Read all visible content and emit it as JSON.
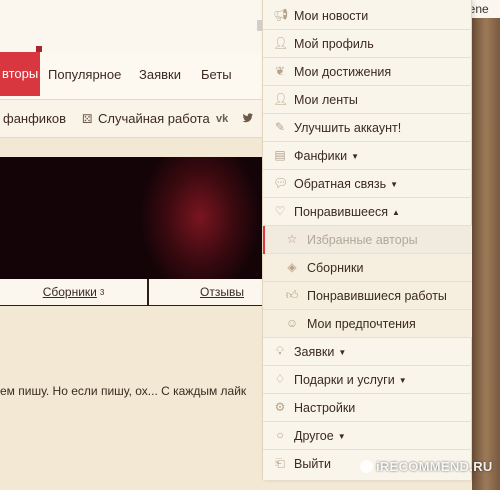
{
  "user": {
    "name": "Eirene"
  },
  "nav": {
    "active_label": "вторы",
    "items": [
      "Популярное",
      "Заявки",
      "Беты"
    ]
  },
  "subnav": {
    "fanfics_label": "фанфиков",
    "random_work_label": "Случайная работа",
    "vk_label": "vk",
    "twitter_icon": "twitter-icon"
  },
  "tabs": {
    "collections_label": "Сборники",
    "collections_count": "3",
    "reviews_label": "Отзывы"
  },
  "body": {
    "text": "ем пишу. Но если пишу, ох... С каждым лайк"
  },
  "menu": {
    "items": [
      {
        "label": "Мои новости",
        "icon": "megaphone-icon"
      },
      {
        "label": "Мой профиль",
        "icon": "user-icon"
      },
      {
        "label": "Мои достижения",
        "icon": "laurel-icon"
      },
      {
        "label": "Мои ленты",
        "icon": "person-feed-icon"
      },
      {
        "label": "Улучшить аккаунт!",
        "icon": "upgrade-icon"
      },
      {
        "label": "Фанфики",
        "icon": "books-icon"
      },
      {
        "label": "Обратная связь",
        "icon": "chat-icon"
      },
      {
        "label": "Понравившееся",
        "icon": "heart-icon"
      },
      {
        "label": "Избранные авторы",
        "icon": "star-icon"
      },
      {
        "label": "Сборники",
        "icon": "layers-icon"
      },
      {
        "label": "Понравившиеся работы",
        "icon": "thumbs-up-icon"
      },
      {
        "label": "Мои предпочтения",
        "icon": "masks-icon"
      },
      {
        "label": "Заявки",
        "icon": "lightbulb-icon"
      },
      {
        "label": "Подарки и услуги",
        "icon": "gift-icon"
      },
      {
        "label": "Настройки",
        "icon": "gear-icon"
      },
      {
        "label": "Другое",
        "icon": "circle-icon"
      },
      {
        "label": "Выйти",
        "icon": "logout-icon"
      }
    ]
  },
  "watermark": {
    "text": "iRECOMMEND.RU"
  },
  "colors": {
    "accent": "#d8373f",
    "menu_bg": "#faf5ea",
    "page_bg": "#f3e8d4"
  }
}
